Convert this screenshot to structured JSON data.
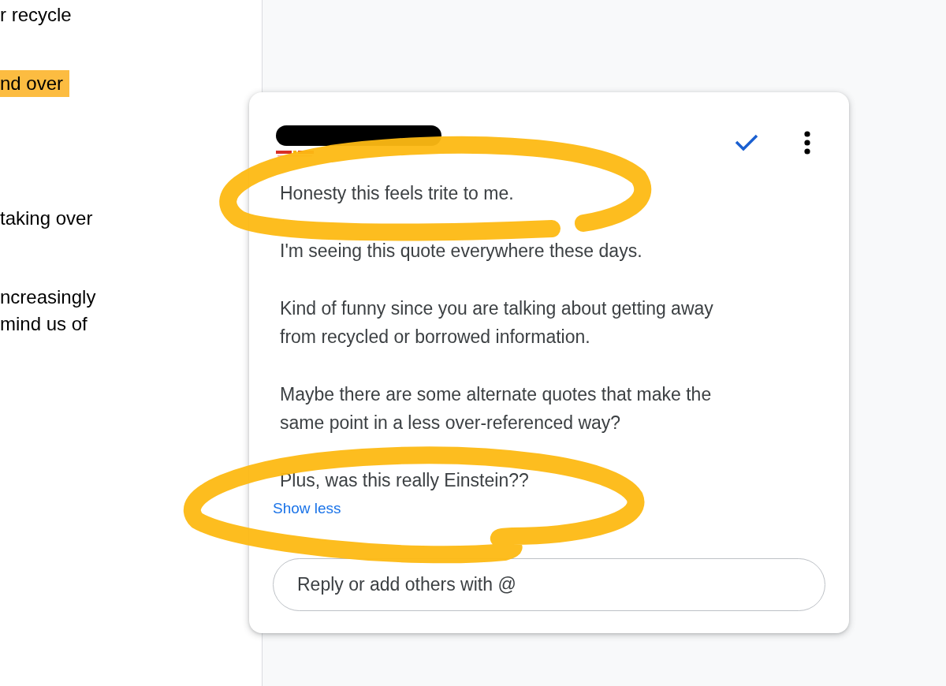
{
  "document": {
    "paragraphs": [
      {
        "lines": [
          {
            "text": "r recycle",
            "highlighted": false
          }
        ]
      },
      {
        "lines": [
          {
            "text": "nd over",
            "highlighted": true
          }
        ]
      },
      {
        "lines": [
          {
            "text": "taking over",
            "highlighted": false
          }
        ]
      },
      {
        "lines": [
          {
            "text": "ncreasingly",
            "highlighted": false
          },
          {
            "text": "mind us of",
            "highlighted": false
          }
        ]
      }
    ]
  },
  "comment": {
    "paragraphs": [
      {
        "lines": [
          "Honesty this feels trite to me."
        ]
      },
      {
        "lines": [
          "I'm seeing this quote everywhere these days."
        ]
      },
      {
        "lines": [
          "Kind of funny since you are talking about getting away",
          "from recycled or borrowed information."
        ]
      },
      {
        "lines": [
          "Maybe there are some alternate quotes that make the",
          "same point in a less over-referenced way?"
        ]
      },
      {
        "lines": [
          "Plus, was this really Einstein??"
        ]
      }
    ],
    "show_less": "Show less",
    "reply": {
      "placeholder": "Reply or add others with @"
    }
  }
}
